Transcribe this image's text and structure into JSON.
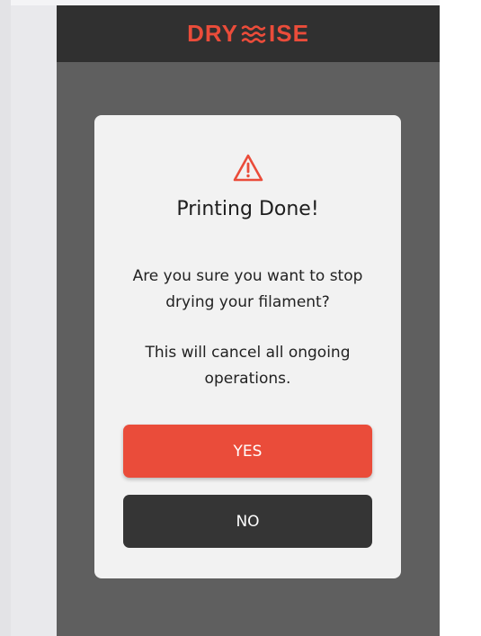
{
  "app": {
    "logo_left": "DRY",
    "logo_right": "ISE",
    "logo_mark_icon": "wave-lines-icon"
  },
  "dialog": {
    "icon": "warning-triangle-icon",
    "title": "Printing Done!",
    "message_line1": "Are you sure you want to stop drying your filament?",
    "message_line2": "This will cancel all ongoing operations.",
    "yes_label": "YES",
    "no_label": "NO"
  },
  "colors": {
    "accent": "#ea4c3a",
    "header_bg": "#303030",
    "backdrop": "#5f5f5f",
    "modal_bg": "#f2f2f2",
    "no_button": "#353535"
  }
}
